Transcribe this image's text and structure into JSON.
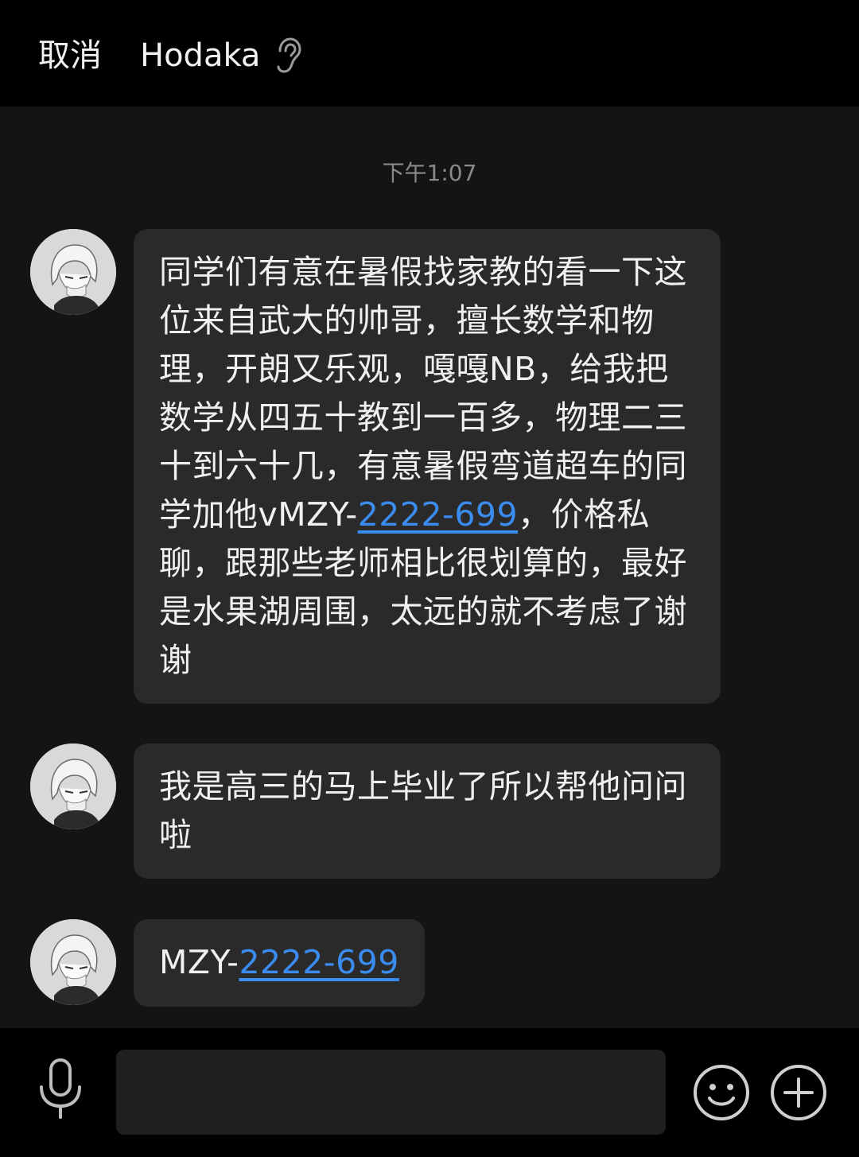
{
  "header": {
    "cancel_label": "取消",
    "contact_name": "Hodaka",
    "ear_icon": "ear-icon"
  },
  "chat": {
    "timestamp": "下午1:07",
    "messages": [
      {
        "avatar_icon": "anime-avatar",
        "text_before": "同学们有意在暑假找家教的看一下这位来自武大的帅哥，擅长数学和物理，开朗又乐观，嘎嘎NB，给我把数学从四五十教到一百多，物理二三十到六十几，有意暑假弯道超车的同学加他vMZY-",
        "link": "2222-699",
        "text_after": "，价格私聊，跟那些老师相比很划算的，最好是水果湖周围，太远的就不考虑了谢谢"
      },
      {
        "avatar_icon": "anime-avatar",
        "text": "我是高三的马上毕业了所以帮他问问啦"
      },
      {
        "avatar_icon": "anime-avatar",
        "text_before": "MZY-",
        "link": "2222-699"
      }
    ]
  },
  "footer": {
    "mic_icon": "microphone-icon",
    "input_value": "",
    "emoji_icon": "smiley-icon",
    "plus_icon": "plus-circle-icon"
  },
  "colors": {
    "link": "#3b8cf0",
    "bubble": "#2a2a2a",
    "background": "#141414",
    "bars": "#000000"
  }
}
